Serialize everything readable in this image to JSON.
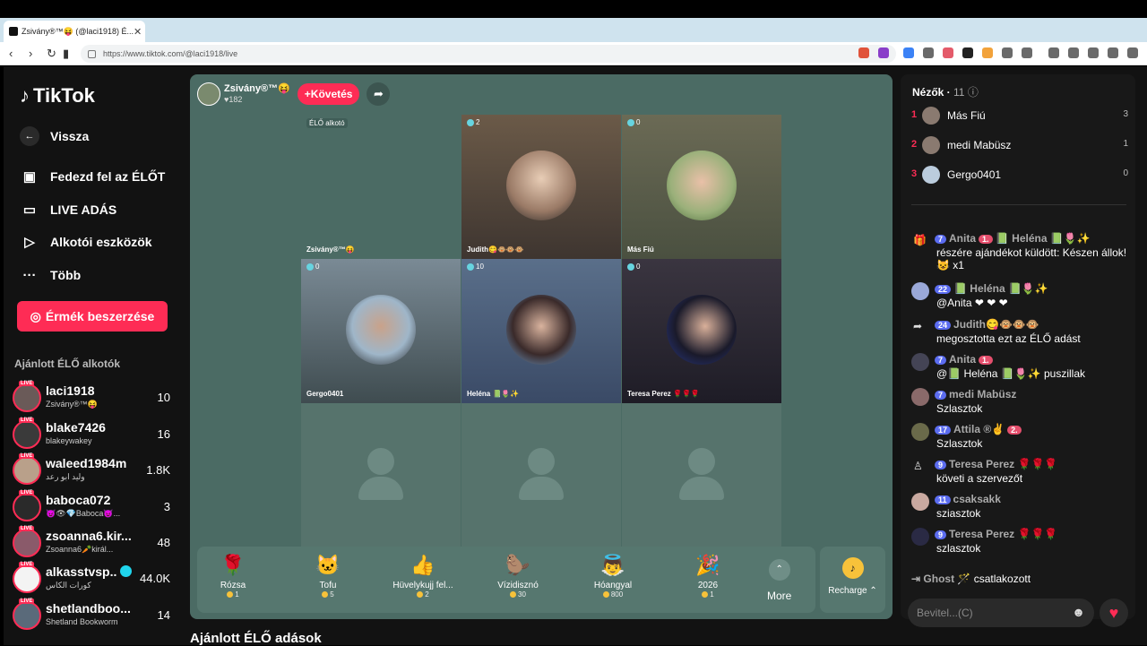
{
  "browser": {
    "tab_title": "Zsivány®™😝 (@laci1918) É...",
    "url": "https://www.tiktok.com/@laci1918/live"
  },
  "nav": {
    "logo": "TikTok",
    "back": "Vissza",
    "items": [
      {
        "label": "Fedezd fel az ÉLŐT"
      },
      {
        "label": "LIVE ADÁS"
      },
      {
        "label": "Alkotói eszközök"
      },
      {
        "label": "Több"
      }
    ],
    "coin_button": "Érmék beszerzése",
    "recommended_title": "Ajánlott ÉLŐ alkotók",
    "creators": [
      {
        "name": "laci1918",
        "sub": "Zsivány®™😝",
        "count": "10"
      },
      {
        "name": "blake7426",
        "sub": "blakeywakey",
        "count": "16"
      },
      {
        "name": "waleed1984m",
        "sub": "وليد ابو رعد",
        "count": "1.8K"
      },
      {
        "name": "baboca072",
        "sub": "😈👁💎Baboca😈...",
        "count": "3"
      },
      {
        "name": "zsoanna6.kir...",
        "sub": "Zsoanna6🥕királ...",
        "count": "48"
      },
      {
        "name": "alkasstvsp...",
        "sub": "كورات الكاس",
        "count": "44.0K"
      },
      {
        "name": "shetlandboo...",
        "sub": "Shetland Bookworm",
        "count": "14"
      }
    ]
  },
  "stream": {
    "host_name": "Zsivány®™😝",
    "host_likes": "♥182",
    "follow": "+Követés",
    "cells": [
      {
        "count": "",
        "name": "Zsivány®™😝",
        "top_label": "ÉLŐ alkotó"
      },
      {
        "count": "2",
        "name": "Judith😋🐵🐵🐵"
      },
      {
        "count": "0",
        "name": "Más Fiú"
      },
      {
        "count": "0",
        "name": "Gergo0401"
      },
      {
        "count": "10",
        "name": "Heléna 📗🌷✨"
      },
      {
        "count": "0",
        "name": "Teresa Perez 🌹🌹🌹"
      }
    ],
    "gifts": [
      {
        "name": "Rózsa",
        "price": "1",
        "icon": "🌹"
      },
      {
        "name": "Tofu",
        "price": "5",
        "icon": "🐱"
      },
      {
        "name": "Hüvelykujj fel...",
        "price": "2",
        "icon": "👍"
      },
      {
        "name": "Vízidisznó",
        "price": "30",
        "icon": "🦫"
      },
      {
        "name": "Hóangyal",
        "price": "800",
        "icon": "👼"
      },
      {
        "name": "2026",
        "price": "1",
        "icon": "🎉"
      }
    ],
    "more": "More",
    "recharge": "Recharge",
    "below_title": "Ajánlott ÉLŐ adások"
  },
  "panel": {
    "title": "Nézők",
    "viewer_count": "11",
    "viewers": [
      {
        "rank": "1",
        "name": "Más Fiú",
        "score": "3"
      },
      {
        "rank": "2",
        "name": "medi Mabüsz",
        "score": "1"
      },
      {
        "rank": "3",
        "name": "Gergo0401",
        "score": "0"
      }
    ],
    "messages": [
      {
        "level": "7",
        "user": "Anita",
        "fan": "1.",
        "line1_extra": "📗 Heléna 📗🌷✨",
        "text": "részére ajándékot küldött: Készen állok! 😺 x1"
      },
      {
        "level": "22",
        "user": "📗 Heléna 📗🌷✨",
        "fan": "",
        "line1_extra": "",
        "text": "@Anita ❤ ❤ ❤"
      },
      {
        "level": "24",
        "user": "Judith😋🐵🐵🐵",
        "fan": "",
        "line1_extra": "",
        "text": "megosztotta ezt az ÉLŐ adást"
      },
      {
        "level": "7",
        "user": "Anita",
        "fan": "1.",
        "line1_extra": "",
        "text": "@📗 Heléna 📗🌷✨ puszillak"
      },
      {
        "level": "7",
        "user": "medi Mabüsz",
        "fan": "",
        "line1_extra": "",
        "text": "Szlasztok"
      },
      {
        "level": "17",
        "user": "Attila ®✌",
        "fan": "2.",
        "line1_extra": "",
        "text": "Szlasztok"
      },
      {
        "level": "9",
        "user": "Teresa Perez 🌹🌹🌹",
        "fan": "",
        "line1_extra": "",
        "text": "követi a szervezőt"
      },
      {
        "level": "11",
        "user": "csaksakk",
        "fan": "",
        "line1_extra": "",
        "text": "sziasztok"
      },
      {
        "level": "9",
        "user": "Teresa Perez 🌹🌹🌹",
        "fan": "",
        "line1_extra": "",
        "text": "szlasztok"
      }
    ],
    "joined_user": "Ghost",
    "joined_text": "csatlakozott",
    "input_placeholder": "Bevitel...(C)"
  }
}
